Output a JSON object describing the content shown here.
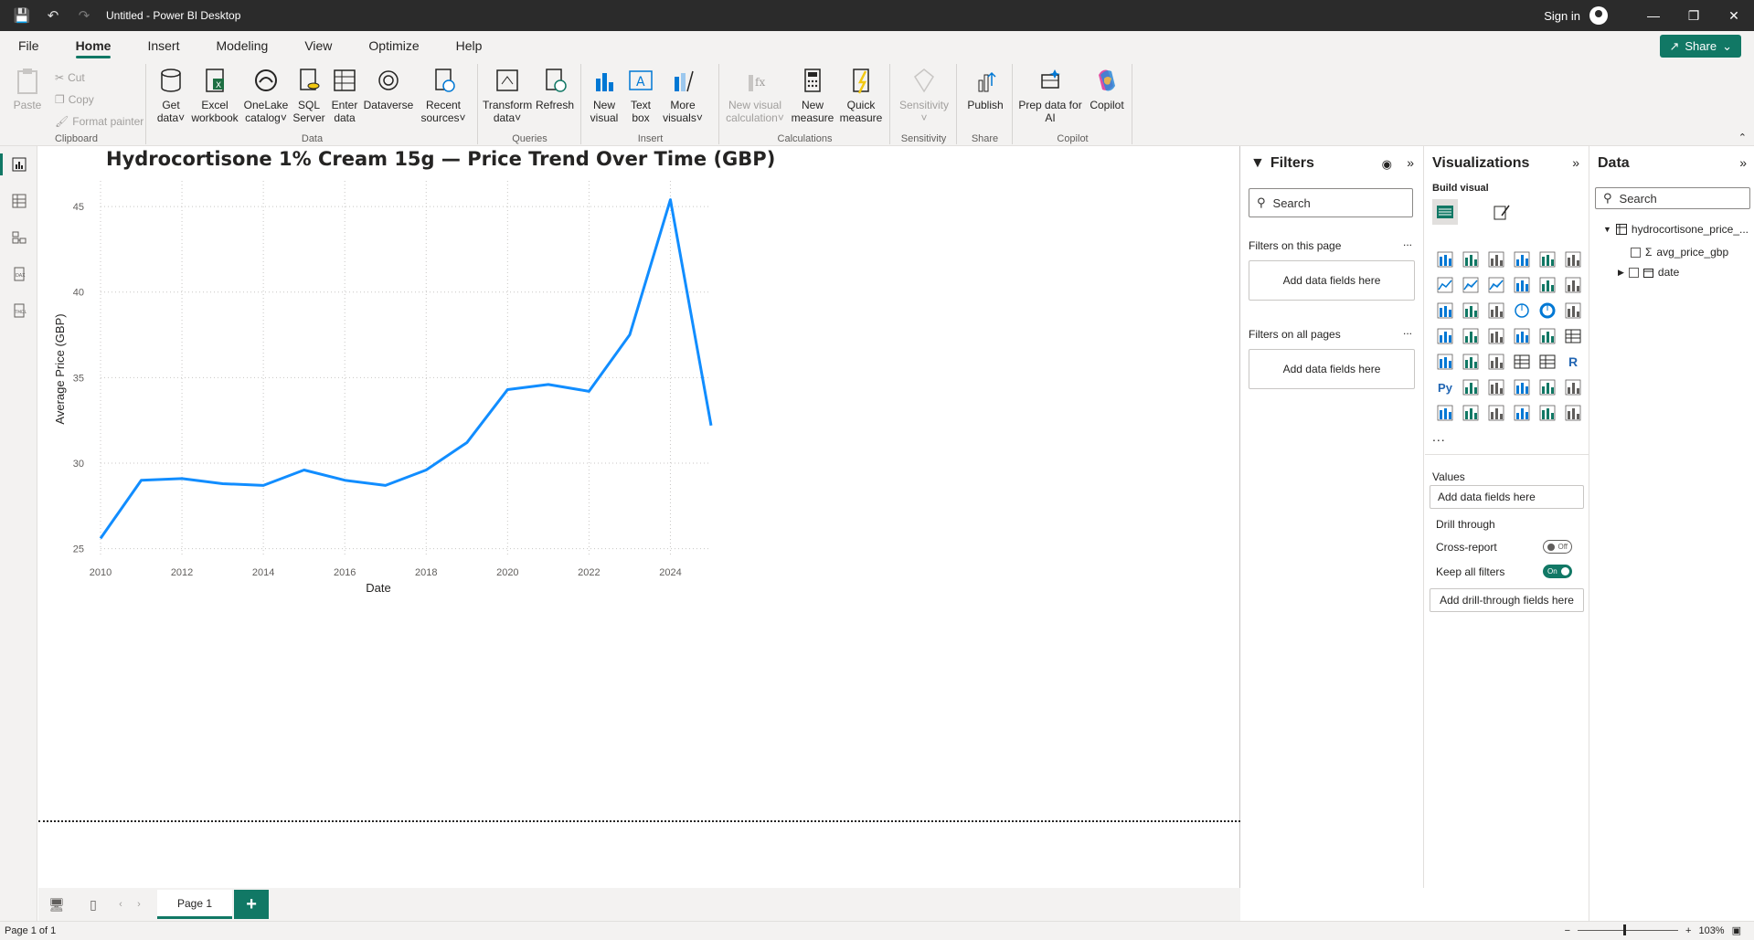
{
  "window": {
    "title": "Untitled - Power BI Desktop",
    "sign_in": "Sign in"
  },
  "menu": {
    "tabs": [
      "File",
      "Home",
      "Insert",
      "Modeling",
      "View",
      "Optimize",
      "Help"
    ],
    "active": "Home",
    "share": "Share"
  },
  "ribbon": {
    "clipboard": {
      "paste": "Paste",
      "cut": "Cut",
      "copy": "Copy",
      "format_painter": "Format painter",
      "label": "Clipboard"
    },
    "data": {
      "get_data": [
        "Get",
        "data"
      ],
      "excel": [
        "Excel",
        "workbook"
      ],
      "onelake": [
        "OneLake",
        "catalog"
      ],
      "sql": [
        "SQL",
        "Server"
      ],
      "enter": [
        "Enter",
        "data"
      ],
      "dataverse": [
        "Dataverse"
      ],
      "recent": [
        "Recent",
        "sources"
      ],
      "label": "Data"
    },
    "queries": {
      "transform": [
        "Transform",
        "data"
      ],
      "refresh": [
        "Refresh"
      ],
      "label": "Queries"
    },
    "insert": {
      "new_visual": [
        "New",
        "visual"
      ],
      "text_box": [
        "Text",
        "box"
      ],
      "more_visuals": [
        "More",
        "visuals"
      ],
      "label": "Insert"
    },
    "calculations": {
      "new_visual_calc": [
        "New visual",
        "calculation"
      ],
      "new_measure": [
        "New",
        "measure"
      ],
      "quick_measure": [
        "Quick",
        "measure"
      ],
      "label": "Calculations"
    },
    "sensitivity": {
      "sensitivity": [
        "Sensitivity"
      ],
      "label": "Sensitivity"
    },
    "share": {
      "publish": [
        "Publish"
      ],
      "label": "Share"
    },
    "copilot": {
      "prep": [
        "Prep data for",
        "AI"
      ],
      "copilot": [
        "Copilot"
      ],
      "label": "Copilot"
    }
  },
  "chart_data": {
    "type": "line",
    "title": "Hydrocortisone 1% Cream 15g — Price Trend Over Time (GBP)",
    "xlabel": "Date",
    "ylabel": "Average Price (GBP)",
    "x": [
      2010,
      2011,
      2012,
      2013,
      2014,
      2015,
      2016,
      2017,
      2018,
      2019,
      2020,
      2021,
      2022,
      2023,
      2024,
      2025
    ],
    "series": [
      {
        "values": [
          25.6,
          29.0,
          29.1,
          28.8,
          28.7,
          29.6,
          29.0,
          28.7,
          29.6,
          31.2,
          34.3,
          34.6,
          34.2,
          37.5,
          45.4,
          32.2
        ]
      }
    ],
    "xticks": [
      2010,
      2012,
      2014,
      2016,
      2018,
      2020,
      2022,
      2024
    ],
    "yticks": [
      25,
      30,
      35,
      40,
      45
    ],
    "xlim": [
      2010,
      2025
    ],
    "ylim": [
      24.5,
      46.5
    ],
    "grid": true,
    "line_color": "#118DFF"
  },
  "pages": {
    "tab": "Page 1",
    "status": "Page 1 of 1",
    "zoom": "103%"
  },
  "filters": {
    "title": "Filters",
    "search": "Search",
    "on_this_page": "Filters on this page",
    "on_all_pages": "Filters on all pages",
    "add_fields": "Add data fields here",
    "more": "..."
  },
  "visualizations": {
    "title": "Visualizations",
    "build_visual": "Build visual",
    "values": "Values",
    "add_fields": "Add data fields here",
    "drill_through": "Drill through",
    "cross_report": "Cross-report",
    "cross_report_state": "Off",
    "keep_all_filters": "Keep all filters",
    "keep_all_filters_state": "On",
    "add_drill": "Add drill-through fields here",
    "more": "..."
  },
  "data_pane": {
    "title": "Data",
    "search": "Search",
    "table": "hydrocortisone_price_...",
    "fields": [
      "avg_price_gbp",
      "date"
    ]
  }
}
